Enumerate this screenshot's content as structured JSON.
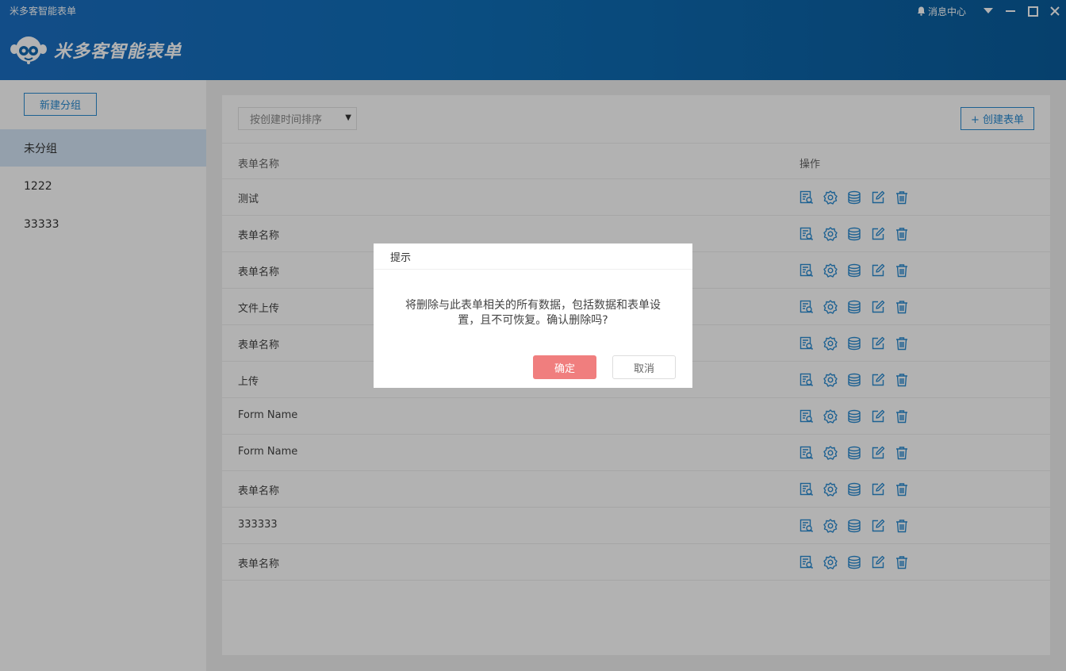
{
  "window": {
    "title": "米多客智能表单",
    "message_center": "消息中心"
  },
  "brand": {
    "logo_text": "米多客智能表单"
  },
  "sidebar": {
    "new_group_label": "新建分组",
    "items": [
      {
        "label": "未分组",
        "active": true
      },
      {
        "label": "1222",
        "active": false
      },
      {
        "label": "33333",
        "active": false
      }
    ]
  },
  "toolbar": {
    "sort_value": "按创建时间排序",
    "create_label": "+ 创建表单"
  },
  "table": {
    "columns": [
      "表单名称",
      "操作"
    ],
    "rows": [
      {
        "name": "测试"
      },
      {
        "name": "表单名称"
      },
      {
        "name": "表单名称"
      },
      {
        "name": "文件上传"
      },
      {
        "name": "表单名称"
      },
      {
        "name": "上传"
      },
      {
        "name": "Form Name"
      },
      {
        "name": "Form Name"
      },
      {
        "name": "表单名称"
      },
      {
        "name": "333333"
      },
      {
        "name": "表单名称"
      }
    ],
    "row_actions": [
      "data-view-icon",
      "settings-icon",
      "database-icon",
      "edit-icon",
      "trash-icon"
    ]
  },
  "dialog": {
    "title": "提示",
    "message": "将删除与此表单相关的所有数据，包括数据和表单设置，且不可恢复。确认删除吗?",
    "confirm_label": "确定",
    "cancel_label": "取消"
  },
  "colors": {
    "accent": "#2a8bd2",
    "header": "#1167b1",
    "confirm": "#f07e7e"
  }
}
